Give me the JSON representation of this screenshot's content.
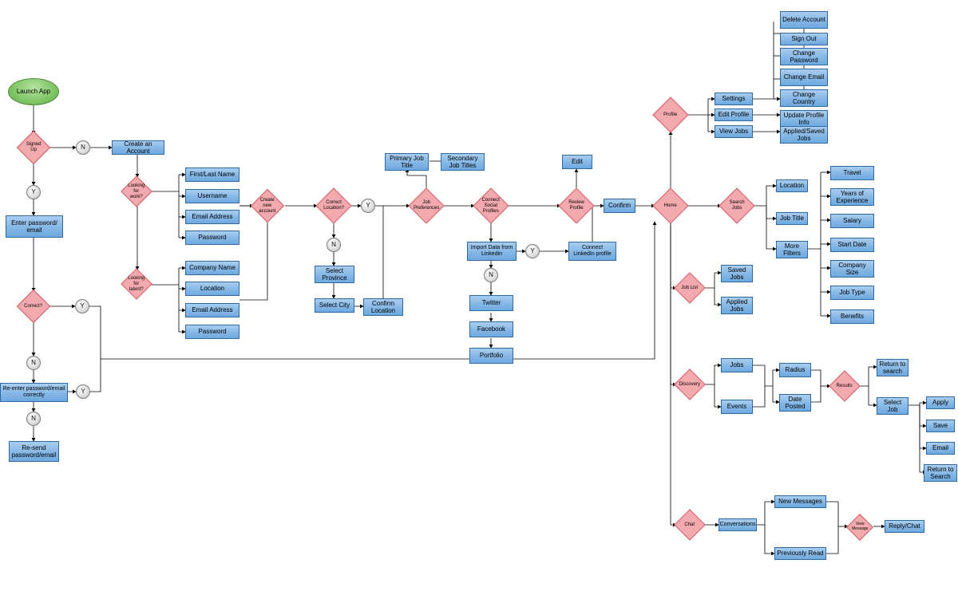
{
  "start": {
    "launch": "Launch App"
  },
  "auth": {
    "signedUp": "Signed Up",
    "createAccount": "Create an Account",
    "enterCreds": "Enter password/ email",
    "correct": "Correct?",
    "reenter": "Re-enter password/email correctly",
    "resend": "Re-send password/email",
    "lookingWork": "Looking for work?",
    "lookingTalent": "Looking for talent?",
    "createNew": "Create new account"
  },
  "workerFields": {
    "name": "First/Last Name",
    "username": "Username",
    "email": "Email Address",
    "password": "Password"
  },
  "companyFields": {
    "name": "Company Name",
    "location": "Location",
    "email": "Email Address",
    "password": "Password"
  },
  "location": {
    "correct": "Correct Location?",
    "selectProvince": "Select Province",
    "selectCity": "Select City",
    "confirm": "Confirm Location"
  },
  "prefs": {
    "jobPrefs": "Job Preferences",
    "primary": "Primary Job Title",
    "secondary": "Secondary Job Titles"
  },
  "social": {
    "connect": "Connect Social Profiles",
    "importLinkedin": "Import Data from Linkedin",
    "connectLinkedin": "Connect LinkedIn profile",
    "twitter": "Twitter",
    "facebook": "Facebook",
    "portfolio": "Portfolio"
  },
  "review": {
    "review": "Review Profile",
    "edit": "Edit",
    "confirm": "Confirm"
  },
  "home": {
    "home": "Home"
  },
  "profile": {
    "profile": "Profile",
    "settings": "Settings",
    "editProfile": "Edit Profile",
    "viewJobs": "View Jobs",
    "deleteAccount": "Delete Account",
    "signOut": "Sign Out",
    "changePassword": "Change Password",
    "changeEmail": "Change Email",
    "changeCountry": "Change Country",
    "updateProfile": "Update Profile Info",
    "appliedSaved": "Applied/Saved Jobs"
  },
  "search": {
    "search": "Search Jobs",
    "location": "Location",
    "jobTitle": "Job Title",
    "moreFilters": "More Filters"
  },
  "filters": {
    "travel": "Travel",
    "years": "Years of Experience",
    "salary": "Salary",
    "startDate": "Start Date",
    "companySize": "Company Size",
    "jobType": "Job Type",
    "benefits": "Benefits"
  },
  "jobList": {
    "jobList": "Job List",
    "saved": "Saved Jobs",
    "applied": "Applied Jobs"
  },
  "discovery": {
    "discovery": "Discovery",
    "jobs": "Jobs",
    "events": "Events",
    "radius": "Radius",
    "datePosted": "Date Posted",
    "results": "Results",
    "returnSearch": "Return to search",
    "selectJob": "Select Job",
    "apply": "Apply",
    "save": "Save",
    "email": "Email",
    "returnSearch2": "Return to Search"
  },
  "chat": {
    "chat": "Chat",
    "conversations": "Conversations",
    "newMessages": "New Messages",
    "prevRead": "Previously Read",
    "viewMessage": "View Message",
    "reply": "Reply/Chat"
  },
  "labels": {
    "Y": "Y",
    "N": "N"
  }
}
